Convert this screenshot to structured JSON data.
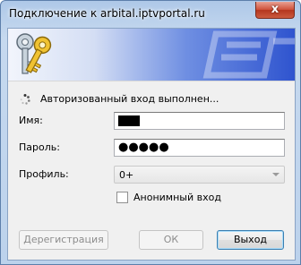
{
  "window": {
    "title": "Подключение к arbital.iptvportal.ru",
    "close_glyph": "x"
  },
  "banner": {
    "icon": "keys-icon",
    "gradient_start": "#f2f5fc",
    "gradient_end": "#2f54cf"
  },
  "status": {
    "icon": "loading-spinner-icon",
    "text": "Авторизованный вход выполнен..."
  },
  "form": {
    "username_label": "Имя:",
    "username_value": "",
    "password_label": "Пароль:",
    "password_value": "●●●●●",
    "profile_label": "Профиль:",
    "profile_value": "0+",
    "anonymous_label": "Анонимный вход",
    "anonymous_checked": false
  },
  "buttons": {
    "register": "Дерегистрация",
    "ok": "ОК",
    "exit": "Выход"
  }
}
